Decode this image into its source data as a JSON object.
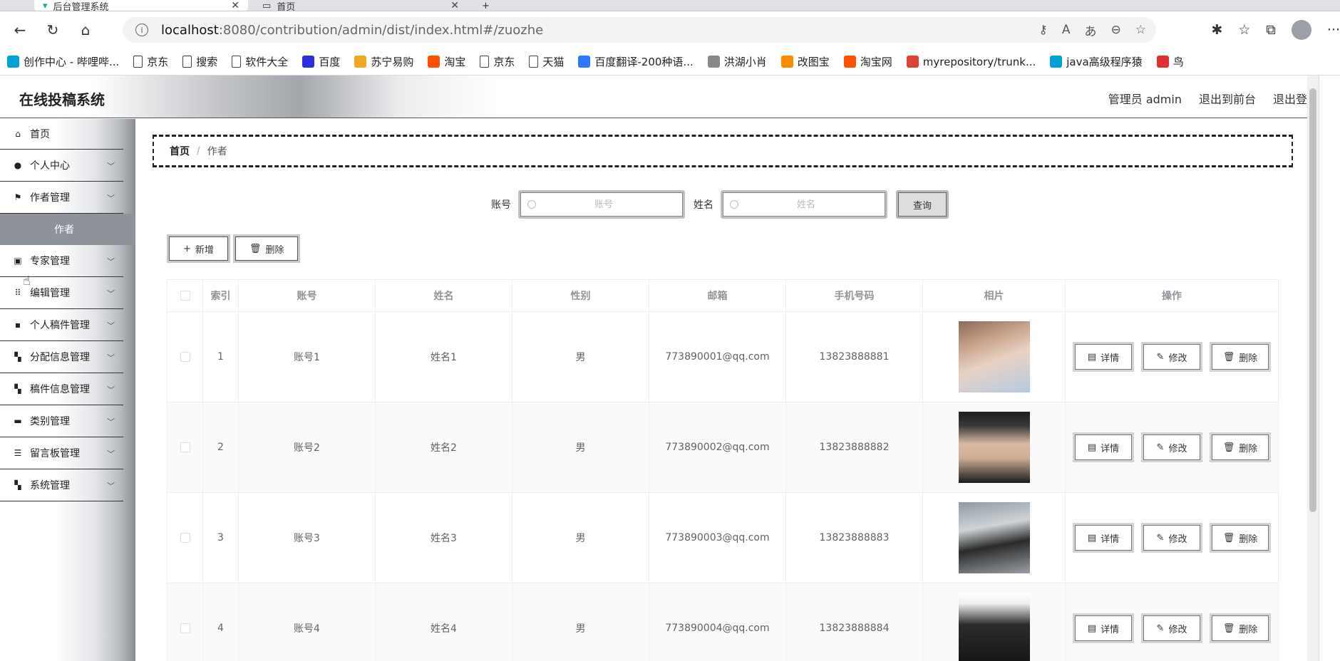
{
  "browser": {
    "tabs": [
      {
        "title": "后台管理系统"
      },
      {
        "title": "首页"
      }
    ],
    "url_host": "localhost",
    "url_path": ":8080/contribution/admin/dist/index.html#/zuozhe",
    "bookmarks": [
      {
        "label": "创作中心 - 哔哩哔...",
        "icon": "bilibili-icon",
        "color": "#00a1d6"
      },
      {
        "label": "京东",
        "icon": "doc-icon"
      },
      {
        "label": "搜索",
        "icon": "doc-icon"
      },
      {
        "label": "软件大全",
        "icon": "doc-icon"
      },
      {
        "label": "百度",
        "icon": "baidu-icon",
        "color": "#2932e1"
      },
      {
        "label": "苏宁易购",
        "icon": "suning-icon",
        "color": "#f5a623"
      },
      {
        "label": "淘宝",
        "icon": "taobao-icon",
        "color": "#ff5000"
      },
      {
        "label": "京东",
        "icon": "doc-icon"
      },
      {
        "label": "天猫",
        "icon": "doc-icon"
      },
      {
        "label": "百度翻译-200种语...",
        "icon": "translate-icon",
        "color": "#2b79ff"
      },
      {
        "label": "洪湖小肖",
        "icon": "hawk-icon",
        "color": "#888888"
      },
      {
        "label": "改图宝",
        "icon": "gaitubao-icon",
        "color": "#ff8a00"
      },
      {
        "label": "淘宝网",
        "icon": "taobao-icon",
        "color": "#ff5000"
      },
      {
        "label": "myrepository/trunk...",
        "icon": "chrome-icon",
        "color": "#db4437"
      },
      {
        "label": "java高级程序猿",
        "icon": "bilibili-icon",
        "color": "#00a1d6"
      },
      {
        "label": "鸟",
        "icon": "bird-icon",
        "color": "#e03030"
      }
    ]
  },
  "app": {
    "title": "在线投稿系统",
    "header": {
      "admin": "管理员 admin",
      "to_front": "退出到前台",
      "logout": "退出登录"
    },
    "sidebar": {
      "home": "首页",
      "personal_center": "个人中心",
      "author_mgmt": "作者管理",
      "author_sub": "作者",
      "expert_mgmt": "专家管理",
      "editor_mgmt": "编辑管理",
      "manuscript_mgmt": "个人稿件管理",
      "assign_mgmt": "分配信息管理",
      "manuscript_info_mgmt": "稿件信息管理",
      "category_mgmt": "类别管理",
      "board_mgmt": "留言板管理",
      "system_mgmt": "系统管理"
    },
    "breadcrumb": {
      "home": "首页",
      "sep": "/",
      "current": "作者"
    },
    "search": {
      "account_label": "账号",
      "account_placeholder": "账号",
      "name_label": "姓名",
      "name_placeholder": "姓名",
      "query_button": "查询"
    },
    "actions": {
      "add": "新增",
      "delete": "删除"
    },
    "table": {
      "headers": {
        "index": "索引",
        "account": "账号",
        "name": "姓名",
        "gender": "性别",
        "email": "邮箱",
        "phone": "手机号码",
        "photo": "相片",
        "ops": "操作"
      },
      "op_labels": {
        "detail": "详情",
        "edit": "修改",
        "delete": "删除"
      },
      "rows": [
        {
          "index": "1",
          "account": "账号1",
          "name": "姓名1",
          "gender": "男",
          "email": "773890001@qq.com",
          "phone": "13823888881"
        },
        {
          "index": "2",
          "account": "账号2",
          "name": "姓名2",
          "gender": "男",
          "email": "773890002@qq.com",
          "phone": "13823888882"
        },
        {
          "index": "3",
          "account": "账号3",
          "name": "姓名3",
          "gender": "男",
          "email": "773890003@qq.com",
          "phone": "13823888883"
        },
        {
          "index": "4",
          "account": "账号4",
          "name": "姓名4",
          "gender": "男",
          "email": "773890004@qq.com",
          "phone": "13823888884"
        }
      ]
    }
  }
}
